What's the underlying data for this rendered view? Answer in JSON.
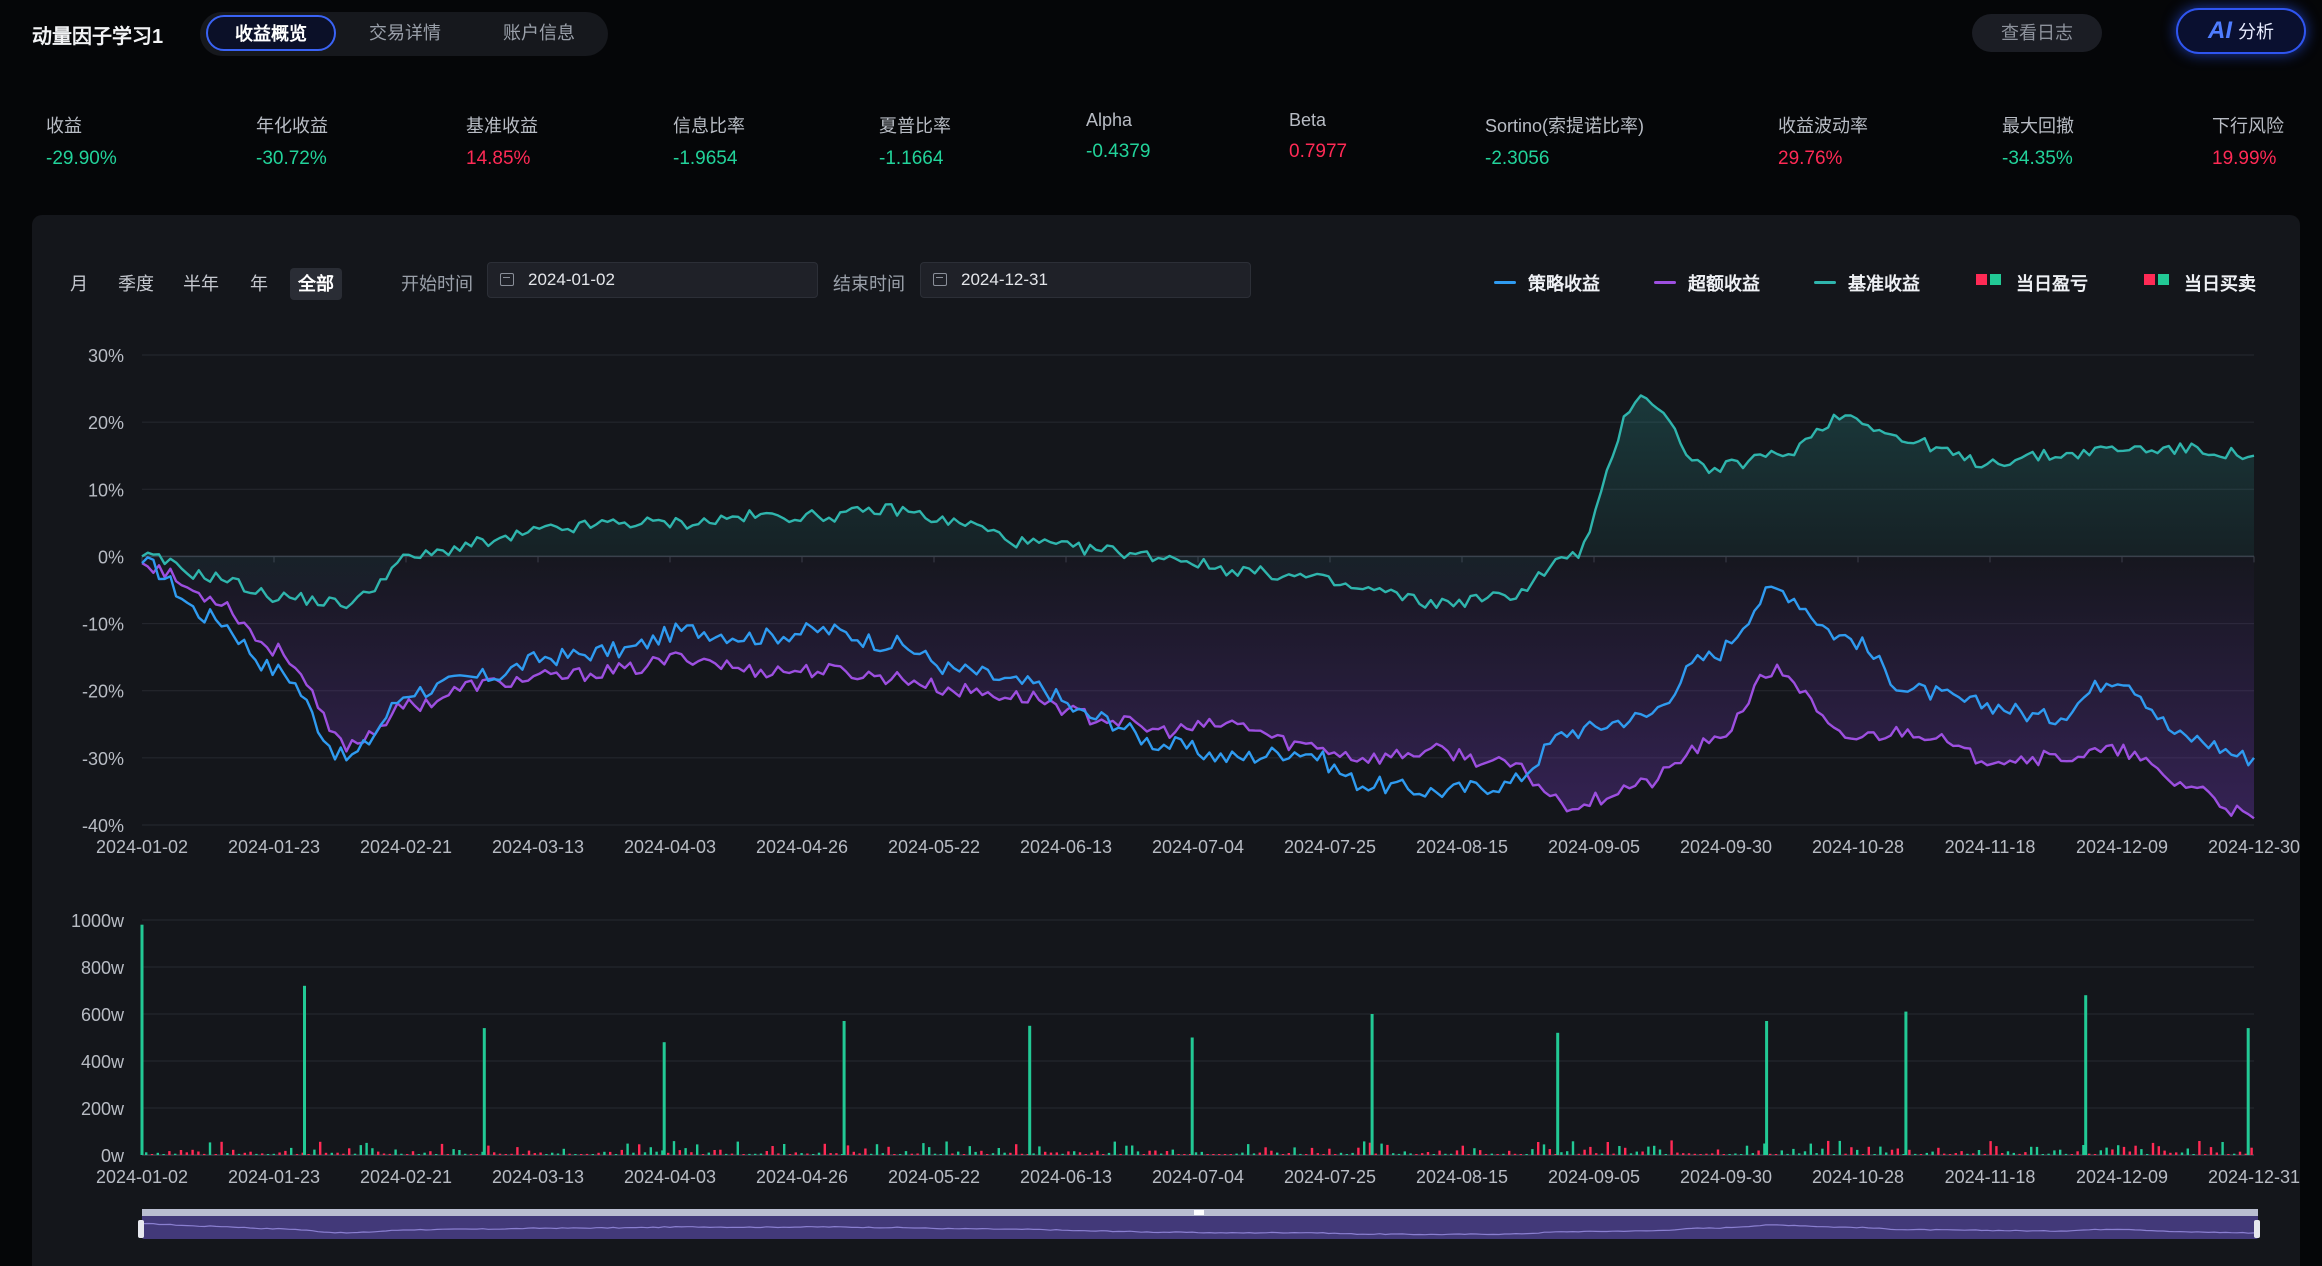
{
  "header": {
    "title": "动量因子学习1",
    "tabs": [
      "收益概览",
      "交易详情",
      "账户信息"
    ],
    "log_button": "查看日志",
    "ai_button": {
      "icon_text": "AI",
      "label": "分析"
    }
  },
  "metrics": [
    {
      "label": "收益",
      "value": "-29.90%",
      "tone": "neg"
    },
    {
      "label": "年化收益",
      "value": "-30.72%",
      "tone": "neg"
    },
    {
      "label": "基准收益",
      "value": "14.85%",
      "tone": "pos"
    },
    {
      "label": "信息比率",
      "value": "-1.9654",
      "tone": "neg"
    },
    {
      "label": "夏普比率",
      "value": "-1.1664",
      "tone": "neg"
    },
    {
      "label": "Alpha",
      "value": "-0.4379",
      "tone": "neg"
    },
    {
      "label": "Beta",
      "value": "0.7977",
      "tone": "pos"
    },
    {
      "label": "Sortino(索提诺比率)",
      "value": "-2.3056",
      "tone": "neg"
    },
    {
      "label": "收益波动率",
      "value": "29.76%",
      "tone": "pos"
    },
    {
      "label": "最大回撤",
      "value": "-34.35%",
      "tone": "neg"
    },
    {
      "label": "下行风险",
      "value": "19.99%",
      "tone": "pos"
    }
  ],
  "filters": {
    "periods": [
      "月",
      "季度",
      "半年",
      "年",
      "全部"
    ],
    "active_period": "全部",
    "start_label": "开始时间",
    "start_value": "2024-01-02",
    "end_label": "结束时间",
    "end_value": "2024-12-31"
  },
  "colors": {
    "strategy": "#2f9bf0",
    "excess": "#9d4fe0",
    "benchmark": "#2fb5ad",
    "profit": "#ff2a55",
    "loss": "#22c995",
    "grid": "#262930",
    "axis_text": "#b8bcc4"
  },
  "legend": [
    {
      "name": "策略收益",
      "kind": "line",
      "color": "#2f9bf0"
    },
    {
      "name": "超额收益",
      "kind": "line",
      "color": "#9d4fe0"
    },
    {
      "name": "基准收益",
      "kind": "line",
      "color": "#2fb5ad"
    },
    {
      "name": "当日盈亏",
      "kind": "squares"
    },
    {
      "name": "当日买卖",
      "kind": "squares"
    }
  ],
  "chart_data": [
    {
      "type": "line",
      "x_labels": [
        "2024-01-02",
        "2024-01-23",
        "2024-02-21",
        "2024-03-13",
        "2024-04-03",
        "2024-04-26",
        "2024-05-22",
        "2024-06-13",
        "2024-07-04",
        "2024-07-25",
        "2024-08-15",
        "2024-09-05",
        "2024-09-30",
        "2024-10-28",
        "2024-11-18",
        "2024-12-09",
        "2024-12-30"
      ],
      "y_ticks": [
        "30%",
        "20%",
        "10%",
        "0%",
        "-10%",
        "-20%",
        "-30%",
        "-40%"
      ],
      "ylim": [
        -40,
        30
      ],
      "series": [
        {
          "name": "策略收益",
          "values": [
            -1,
            -9,
            -17,
            -30,
            -20,
            -18,
            -15,
            -14,
            -11,
            -12,
            -11,
            -13,
            -17,
            -19,
            -24,
            -28,
            -30,
            -29,
            -34,
            -35,
            -34,
            -26,
            -24,
            -15,
            -5,
            -12,
            -20,
            -22,
            -24,
            -18,
            -27,
            -30
          ]
        },
        {
          "name": "超额收益",
          "values": [
            -1,
            -6,
            -14,
            -28,
            -22,
            -19,
            -18,
            -17,
            -15,
            -17,
            -17,
            -18,
            -20,
            -21,
            -24,
            -26,
            -25,
            -28,
            -30,
            -29,
            -31,
            -37,
            -34,
            -28,
            -17,
            -27,
            -26,
            -30,
            -30,
            -29,
            -34,
            -39
          ]
        },
        {
          "name": "基准收益",
          "values": [
            0,
            -3,
            -6,
            -7,
            0,
            2,
            4,
            5,
            5,
            6,
            6,
            7,
            5,
            2,
            1,
            0,
            -2,
            -3,
            -5,
            -7,
            -6,
            0,
            24,
            13,
            15,
            21,
            17,
            14,
            15,
            16,
            16,
            15
          ]
        }
      ]
    },
    {
      "type": "bar",
      "x_labels": [
        "2024-01-02",
        "2024-01-23",
        "2024-02-21",
        "2024-03-13",
        "2024-04-03",
        "2024-04-26",
        "2024-05-22",
        "2024-06-13",
        "2024-07-04",
        "2024-07-25",
        "2024-08-15",
        "2024-09-05",
        "2024-09-30",
        "2024-10-28",
        "2024-11-18",
        "2024-12-09",
        "2024-12-31"
      ],
      "y_ticks": [
        "1000w",
        "800w",
        "600w",
        "400w",
        "200w",
        "0w"
      ],
      "ylim": [
        0,
        1000
      ],
      "spikes": [
        {
          "x": "2024-01-02",
          "value": 980
        },
        {
          "x": "2024-01-30",
          "value": 720
        },
        {
          "x": "2024-03-01",
          "value": 540
        },
        {
          "x": "2024-04-01",
          "value": 480
        },
        {
          "x": "2024-05-02",
          "value": 570
        },
        {
          "x": "2024-06-03",
          "value": 550
        },
        {
          "x": "2024-07-01",
          "value": 500
        },
        {
          "x": "2024-08-01",
          "value": 600
        },
        {
          "x": "2024-09-02",
          "value": 520
        },
        {
          "x": "2024-10-08",
          "value": 570
        },
        {
          "x": "2024-11-01",
          "value": 610
        },
        {
          "x": "2024-12-02",
          "value": 680
        },
        {
          "x": "2024-12-30",
          "value": 540
        }
      ]
    }
  ]
}
